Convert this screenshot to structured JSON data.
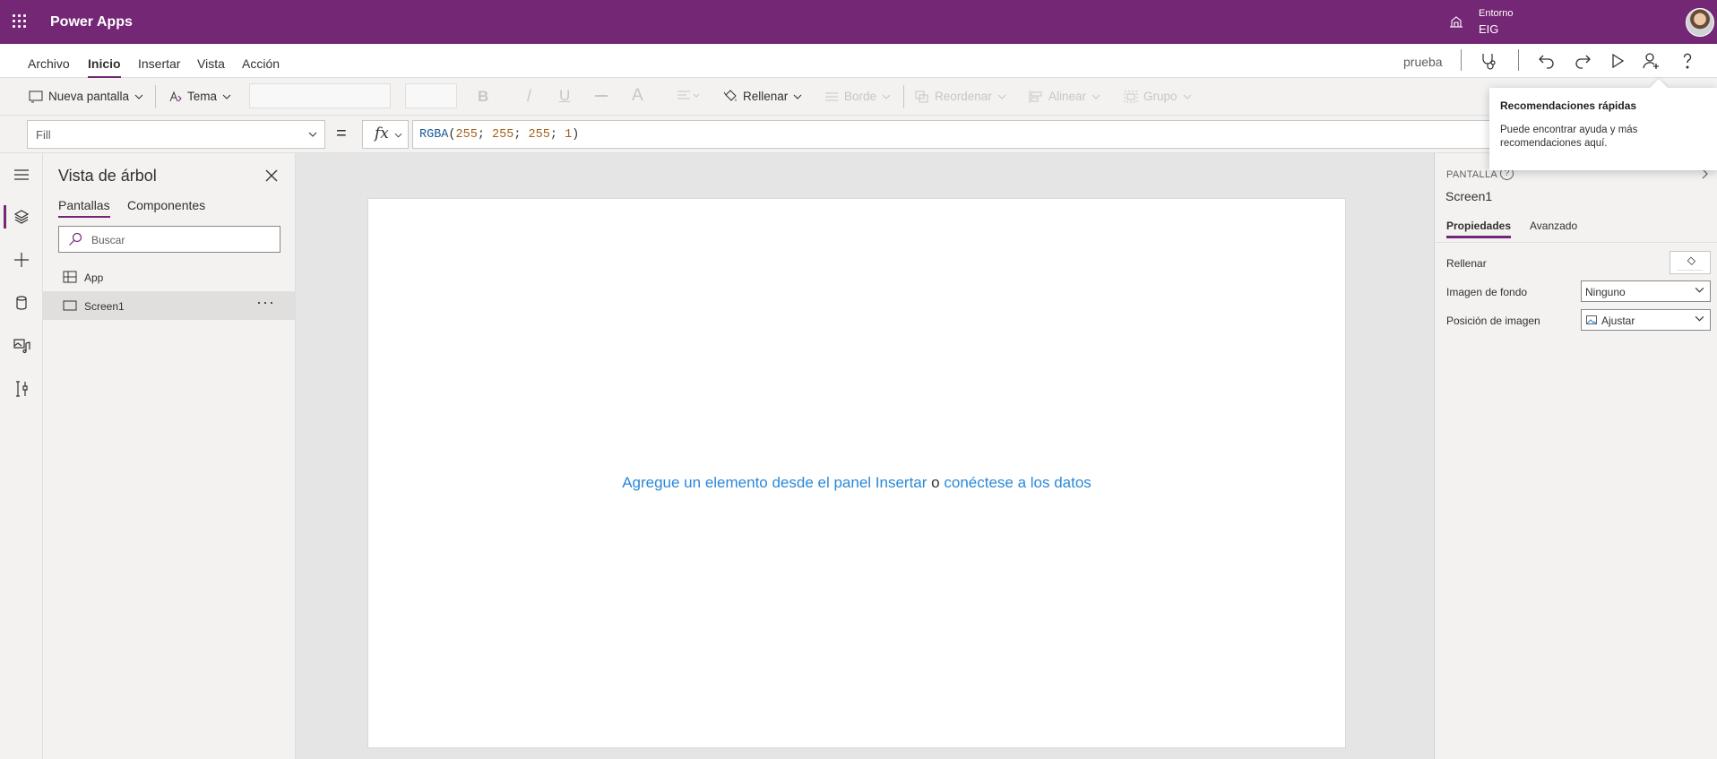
{
  "appbar": {
    "title": "Power Apps",
    "environment_label": "Entorno",
    "environment_value": "EIG"
  },
  "menu": {
    "items": [
      "Archivo",
      "Inicio",
      "Insertar",
      "Vista",
      "Acción"
    ],
    "active": "Inicio",
    "app_name": "prueba"
  },
  "toolbar": {
    "new_screen": "Nueva pantalla",
    "theme": "Tema",
    "fill": "Rellenar",
    "border": "Borde",
    "reorder": "Reordenar",
    "align": "Alinear",
    "group": "Grupo",
    "bold_glyph": "B",
    "italic_glyph": "/",
    "underline_glyph": "U",
    "font_color_glyph": "A"
  },
  "formula": {
    "property": "Fill",
    "equals": "=",
    "fx": "fx",
    "fn": "RGBA",
    "args": [
      "255",
      "255",
      "255",
      "1"
    ]
  },
  "tree": {
    "title": "Vista de árbol",
    "tabs": [
      "Pantallas",
      "Componentes"
    ],
    "search_placeholder": "Buscar",
    "items": [
      {
        "label": "App"
      },
      {
        "label": "Screen1",
        "more": "···"
      }
    ]
  },
  "canvas": {
    "msg_part1": "Agregue un elemento desde el panel Insertar",
    "msg_or": "o",
    "msg_part2": "conéctese a los datos"
  },
  "properties": {
    "type_label": "PANTALLA",
    "help_glyph": "?",
    "name": "Screen1",
    "tabs": [
      "Propiedades",
      "Avanzado"
    ],
    "fill_label": "Rellenar",
    "bg_image_label": "Imagen de fondo",
    "bg_image_value": "Ninguno",
    "image_position_label": "Posición de imagen",
    "image_position_value": "Ajustar"
  },
  "coachmark": {
    "title": "Recomendaciones rápidas",
    "body": "Puede encontrar ayuda y más recomendaciones aquí."
  },
  "colors": {
    "brand": "#742774",
    "link": "#2b88d8",
    "panel_bg": "#f3f2f1"
  }
}
